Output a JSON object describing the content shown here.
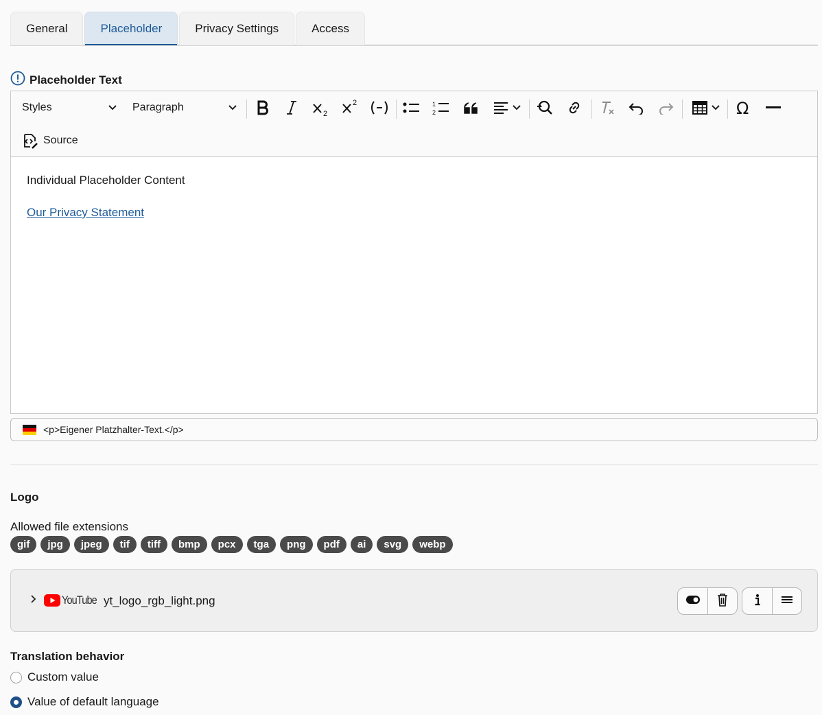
{
  "tabs": [
    {
      "label": "General"
    },
    {
      "label": "Placeholder"
    },
    {
      "label": "Privacy Settings"
    },
    {
      "label": "Access"
    }
  ],
  "placeholder_section": {
    "title": "Placeholder Text"
  },
  "toolbar": {
    "styles_label": "Styles",
    "paragraph_label": "Paragraph",
    "source_label": "Source"
  },
  "editor": {
    "line1": "Individual Placeholder Content",
    "link_text": "Our Privacy Statement"
  },
  "translation_preview": "<p>Eigener Platzhalter-Text.</p>",
  "logo": {
    "title": "Logo",
    "allowed_label": "Allowed file extensions",
    "extensions": [
      "gif",
      "jpg",
      "jpeg",
      "tif",
      "tiff",
      "bmp",
      "pcx",
      "tga",
      "png",
      "pdf",
      "ai",
      "svg",
      "webp"
    ],
    "file_name": "yt_logo_rgb_light.png",
    "thumbnail_text": "YouTube"
  },
  "translation": {
    "title": "Translation behavior",
    "options": [
      "Custom value",
      "Value of default language"
    ],
    "selected": "Value of default language"
  },
  "colors": {
    "accent": "#1f5b99",
    "badge": "#4a4a4a",
    "radio_selected": "#1f4f86"
  }
}
